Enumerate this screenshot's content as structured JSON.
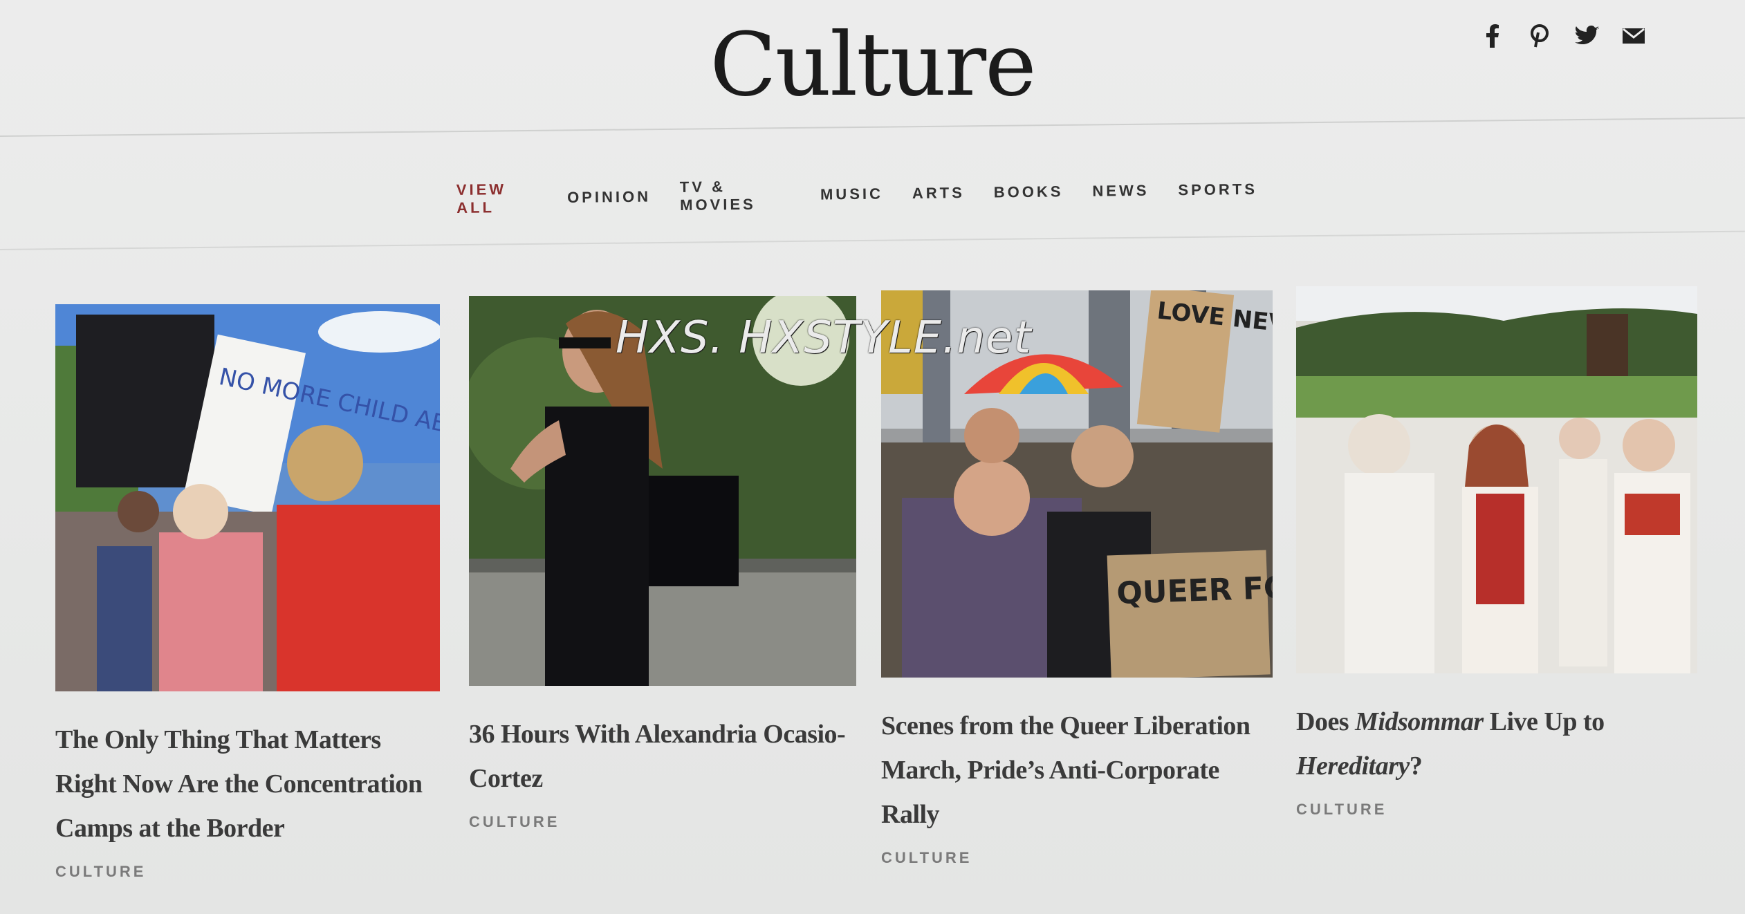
{
  "header": {
    "title": "Culture",
    "social": [
      "facebook-icon",
      "pinterest-icon",
      "twitter-icon",
      "email-icon"
    ]
  },
  "nav": {
    "items": [
      "VIEW ALL",
      "OPINION",
      "TV & MOVIES",
      "MUSIC",
      "ARTS",
      "BOOKS",
      "NEWS",
      "SPORTS"
    ],
    "active": "VIEW ALL",
    "active_color": "#8c2f2f"
  },
  "watermark": "HXS. HXSTYLE.net",
  "cards": [
    {
      "headline": "The Only Thing That Matters Right Now Are the Concentration Camps at the Border",
      "label": "CULTURE",
      "sign_text": "NO MORE CHILD ABUSE IN OUR NAME"
    },
    {
      "headline": "36 Hours With Alexandria Ocasio-Cortez",
      "label": "CULTURE"
    },
    {
      "headline": "Scenes from the Queer Liberation March, Pride’s Anti-Corporate Rally",
      "label": "CULTURE",
      "sign_top": "LOVE NEVER FAILS",
      "sign_bottom": "QUEER FOREVER"
    },
    {
      "headline_pre": "Does ",
      "headline_em1": "Midsommar",
      "headline_mid": " Live Up to ",
      "headline_em2": "Hereditary",
      "headline_post": "?",
      "label": "CULTURE"
    }
  ]
}
